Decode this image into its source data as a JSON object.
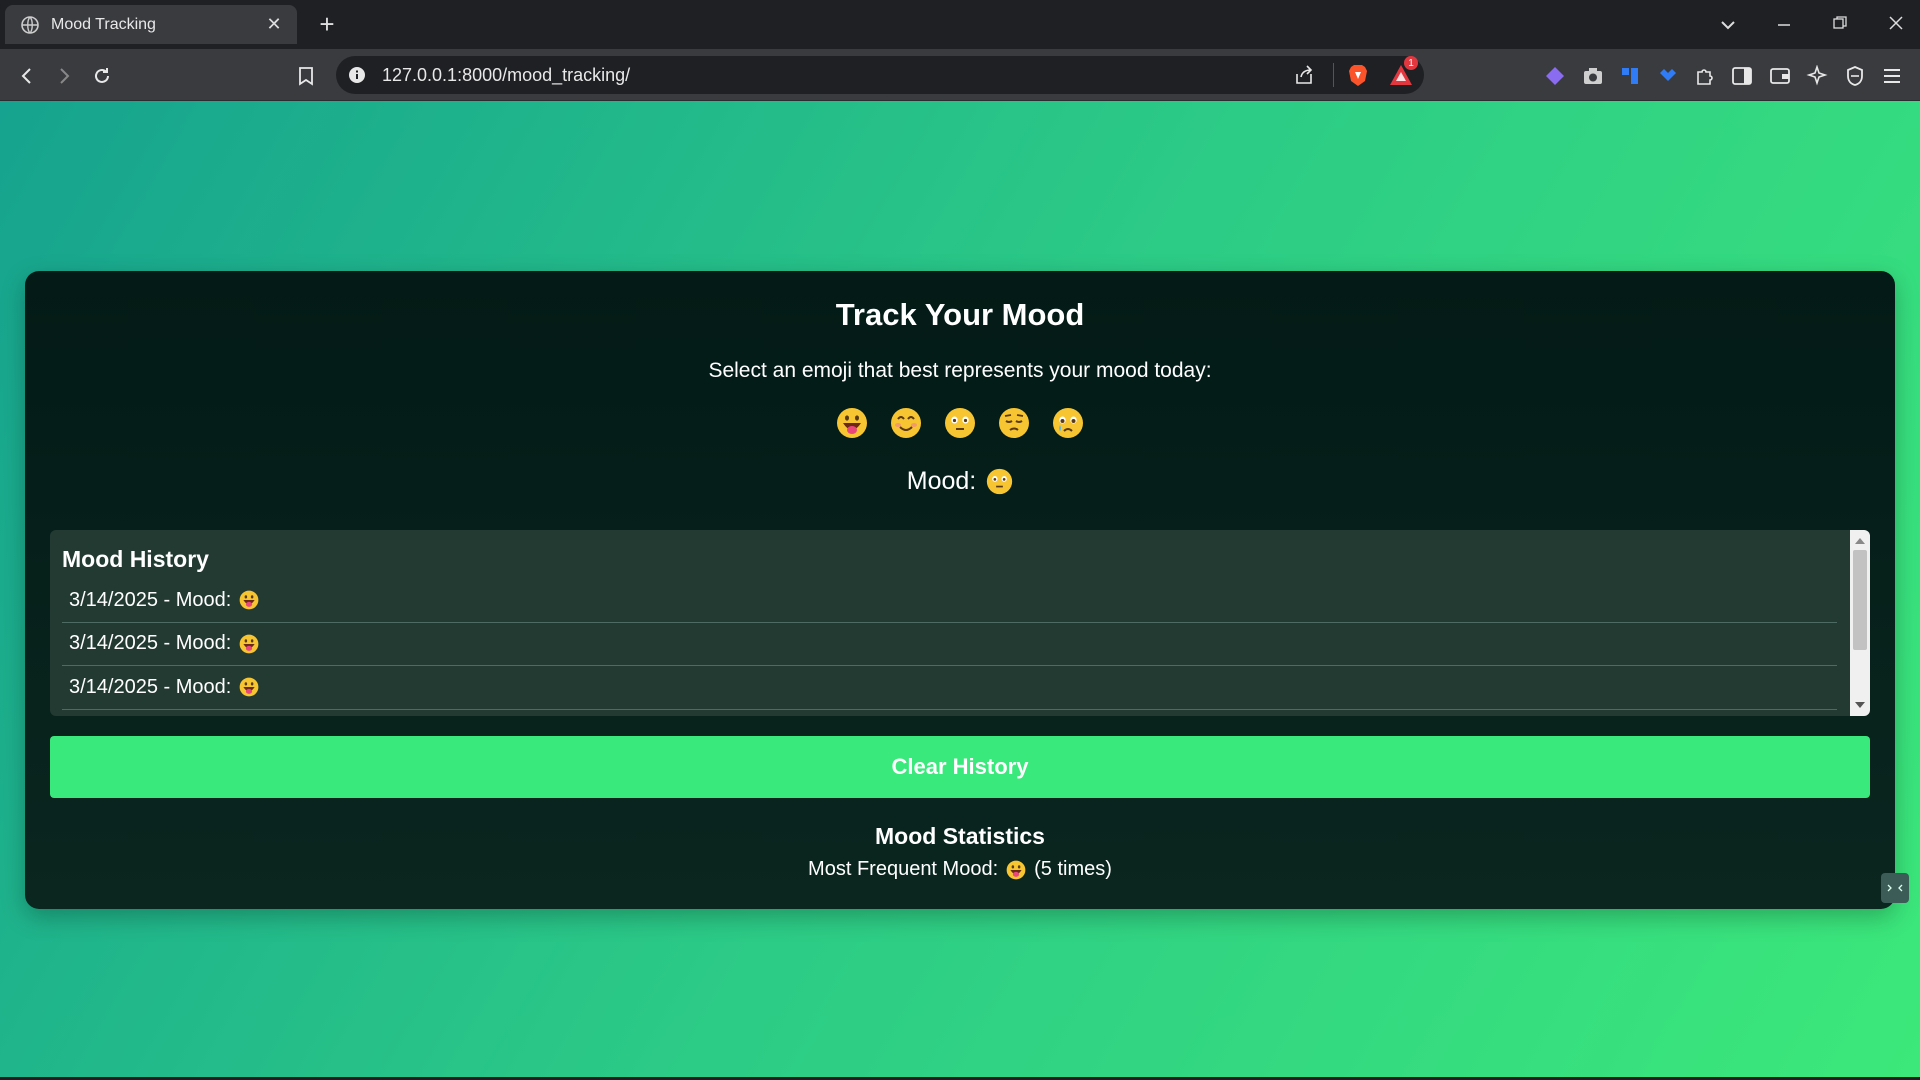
{
  "browser": {
    "tab_title": "Mood Tracking",
    "tab_close": "✕",
    "new_tab": "+",
    "url": "127.0.0.1:8000/mood_tracking/",
    "rewards_badge": "1"
  },
  "page": {
    "heading": "Track Your Mood",
    "prompt": "Select an emoji that best represents your mood today:",
    "emoji_options": [
      "grinning-tongue",
      "smiling-blush",
      "neutral-face",
      "pensive-face",
      "crying-face"
    ],
    "current_mood_label": "Mood:",
    "current_mood": "neutral-face",
    "history_title": "Mood History",
    "history": [
      {
        "text": "3/14/2025 - Mood:",
        "mood": "grinning-tongue"
      },
      {
        "text": "3/14/2025 - Mood:",
        "mood": "grinning-tongue"
      },
      {
        "text": "3/14/2025 - Mood:",
        "mood": "grinning-tongue"
      }
    ],
    "clear_button": "Clear History",
    "stats_title": "Mood Statistics",
    "stats_prefix": "Most Frequent Mood:",
    "stats_mood": "grinning-tongue",
    "stats_suffix": "(5 times)"
  },
  "colors": {
    "accent": "#39e97b",
    "card_bg": "#061f1a",
    "history_bg": "#233a33"
  }
}
